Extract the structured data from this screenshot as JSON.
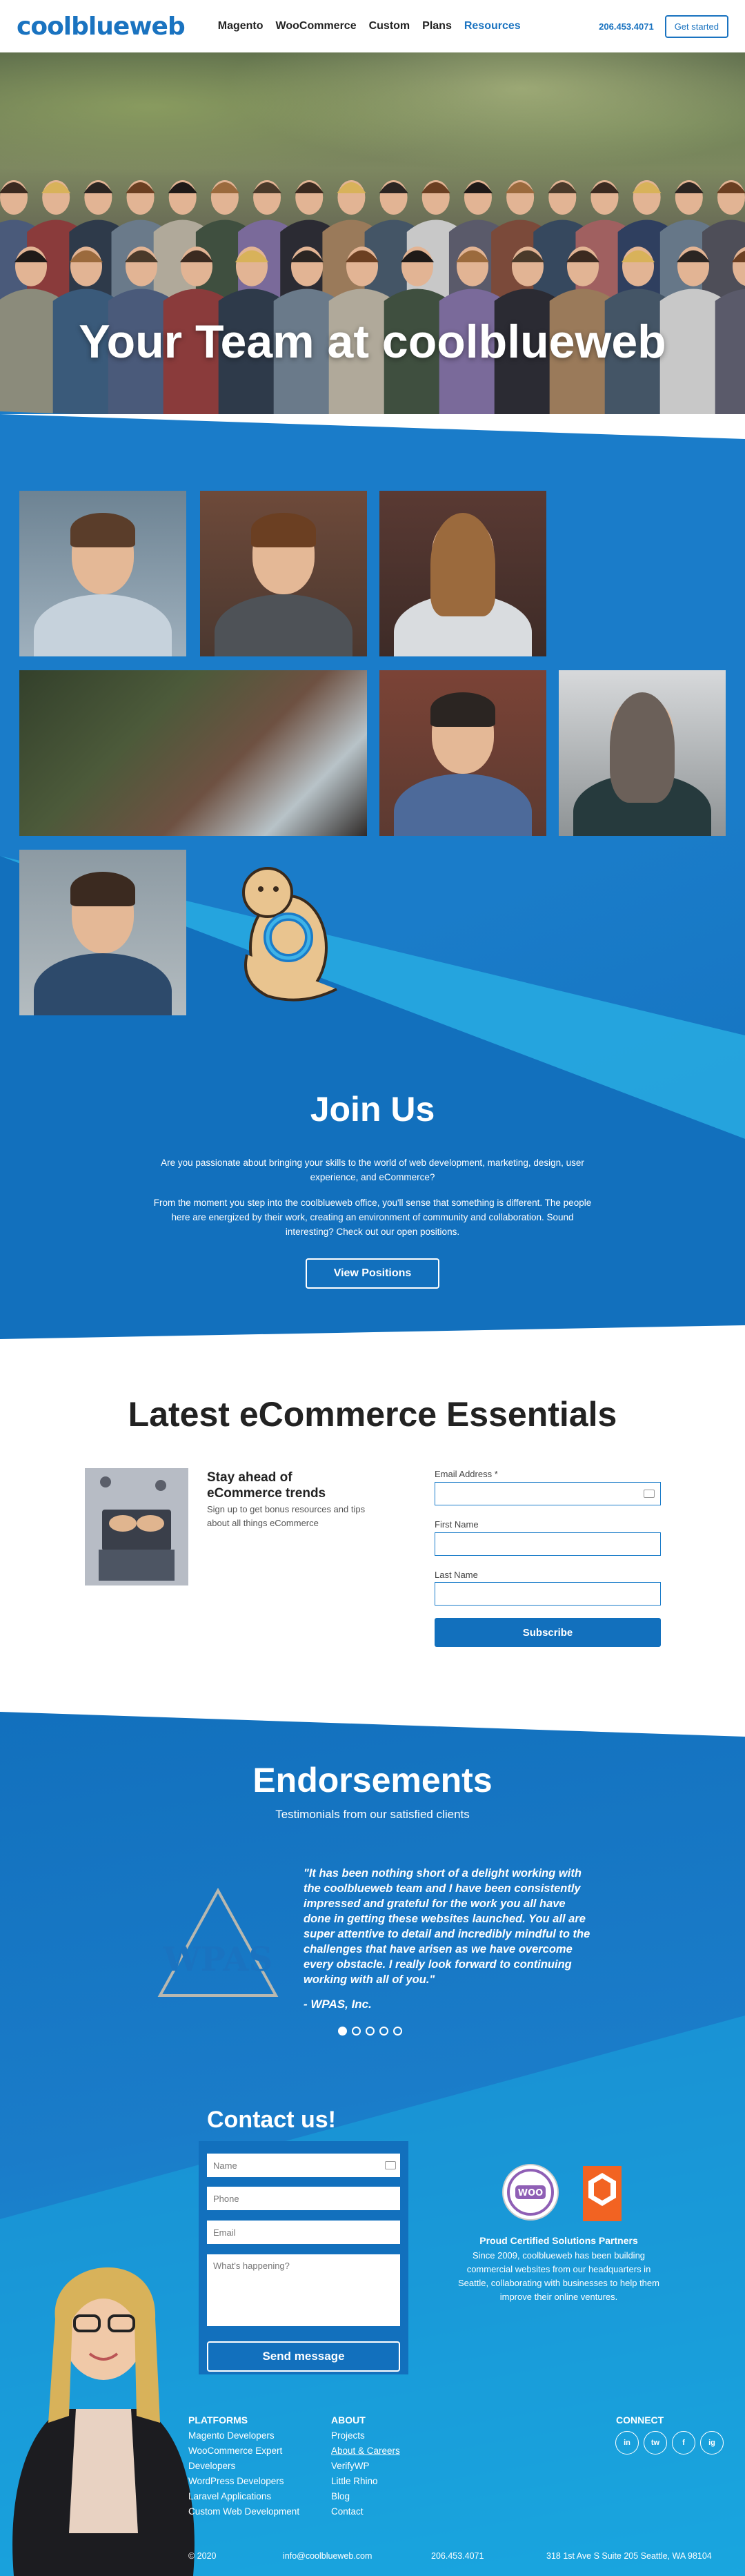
{
  "header": {
    "logo": "coolblueweb",
    "nav": [
      "Magento",
      "WooCommerce",
      "Custom",
      "Plans",
      "Resources"
    ],
    "active_nav": "Resources",
    "phone": "206.453.4071",
    "cta": "Get started"
  },
  "hero": {
    "title": "Your Team at coolblueweb"
  },
  "join": {
    "title": "Join Us",
    "p1": "Are you passionate about bringing your skills to the world of web development, marketing, design, user experience, and eCommerce?",
    "p2": "From the moment you step into the coolblueweb office, you'll sense that something is different. The people here are energized by their work, creating an environment of community and collaboration. Sound interesting? Check out our open positions.",
    "button": "View Positions"
  },
  "latest": {
    "title": "Latest eCommerce Essentials",
    "stay_title": "Stay ahead of eCommerce trends",
    "stay_desc": "Sign up to get bonus resources and tips about all things eCommerce",
    "email_label": "Email Address *",
    "first_label": "First Name",
    "last_label": "Last Name",
    "subscribe": "Subscribe"
  },
  "endorsements": {
    "title": "Endorsements",
    "subtitle": "Testimonials from our satisfied clients",
    "logo_text": "WPAS",
    "quote": "\"It has been nothing short of a delight working with the coolblueweb team and I have been consistently impressed and grateful for the work you all have done in getting these websites launched. You all are super attentive to detail and incredibly mindful to the challenges that have arisen as we have overcome every obstacle. I really look forward to continuing working with all of you.\"",
    "author": "- WPAS, Inc.",
    "slide_count": 5,
    "active_slide": 1
  },
  "contact": {
    "title": "Contact us!",
    "name_ph": "Name",
    "phone_ph": "Phone",
    "email_ph": "Email",
    "message_ph": "What's happening?",
    "send": "Send message",
    "badge_woo": "WOO",
    "partners_title": "Proud Certified Solutions Partners",
    "partners_desc": "Since 2009, coolblueweb has been building commercial websites from our headquarters in Seattle, collaborating with businesses to help them improve their online ventures."
  },
  "footer": {
    "platforms_title": "PLATFORMS",
    "platforms": [
      "Magento Developers",
      "WooCommerce Expert Developers",
      "WordPress Developers",
      "Laravel Applications",
      "Custom Web Development"
    ],
    "about_title": "ABOUT",
    "about": [
      "Projects",
      "About & Careers",
      "VerifyWP",
      "Little Rhino",
      "Blog",
      "Contact"
    ],
    "connect_title": "CONNECT",
    "social": [
      "in",
      "tw",
      "f",
      "ig"
    ],
    "copyright": "© 2020",
    "email": "info@coolblueweb.com",
    "phone": "206.453.4071",
    "address": "318 1st Ave S Suite 205 Seattle, WA 98104"
  },
  "colors": {
    "brand": "#1a73c0",
    "section_blue": "#1a7cc9",
    "dark_blue": "#1270bd",
    "light_blue": "#1aa6df"
  }
}
